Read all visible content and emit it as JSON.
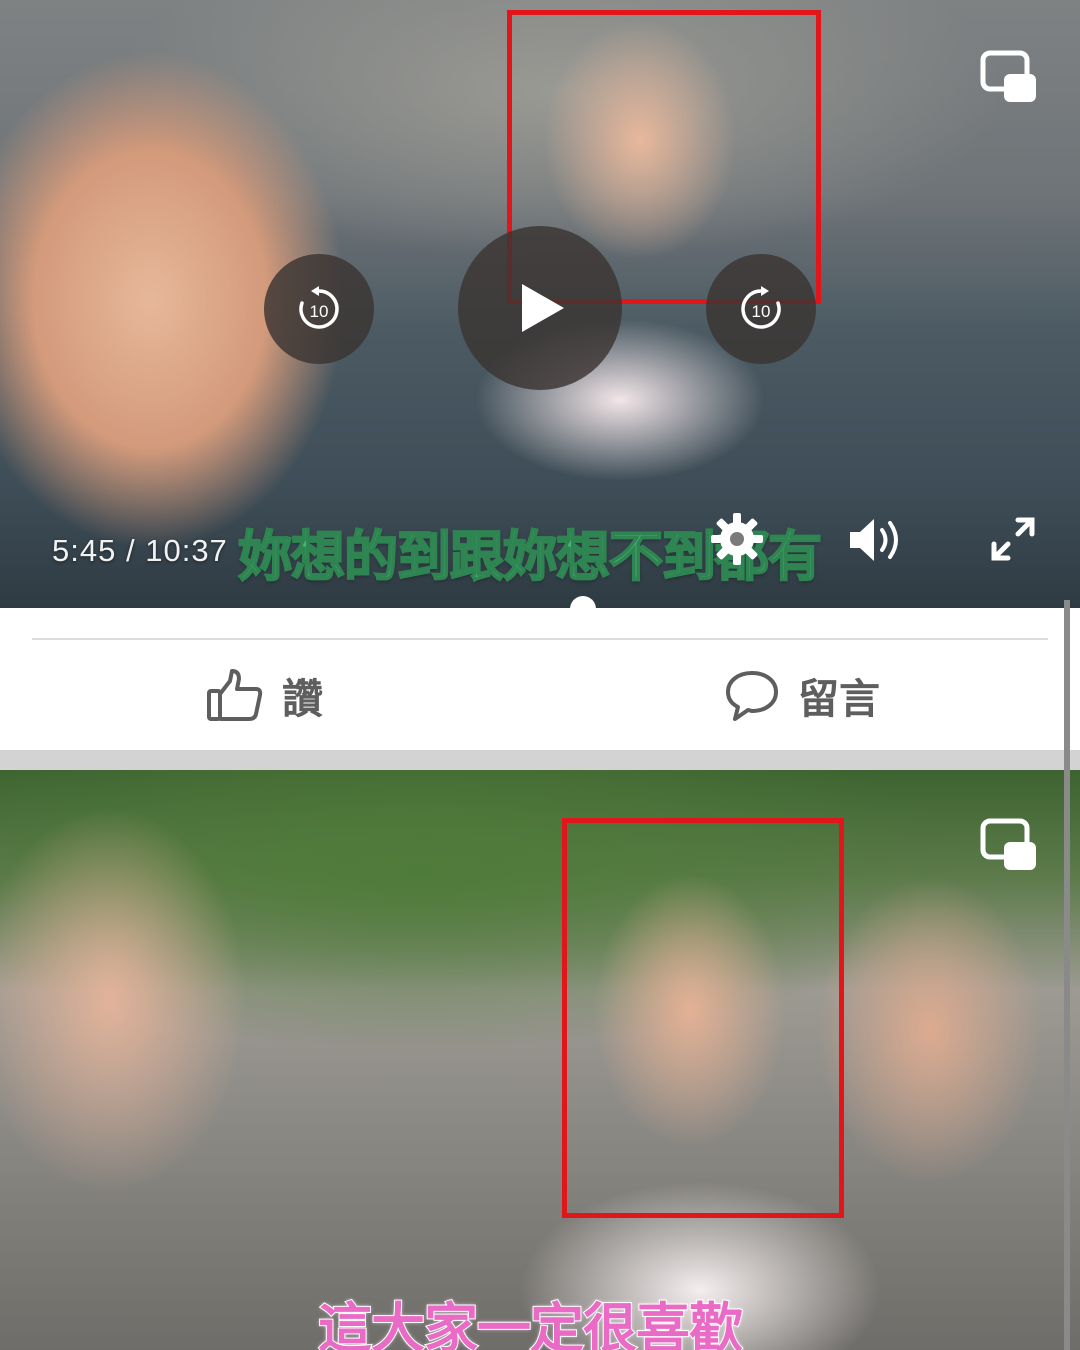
{
  "video_top": {
    "current_time": "5:45",
    "duration": "10:37",
    "time_separator": "/",
    "subtitle": "妳想的到跟妳想不到都有",
    "controls": {
      "rewind_seconds": "10",
      "forward_seconds": "10"
    },
    "highlight_color": "#e0161b",
    "subtitle_color": "#4eb77a"
  },
  "post_actions": {
    "like_label": "讚",
    "comment_label": "留言",
    "icons": [
      "thumbs-up-icon",
      "comment-bubble-icon"
    ]
  },
  "video_bottom": {
    "subtitle": "這大家一定很喜歡",
    "subtitle_color": "#ea6bc5",
    "highlight_color": "#e0161b"
  }
}
